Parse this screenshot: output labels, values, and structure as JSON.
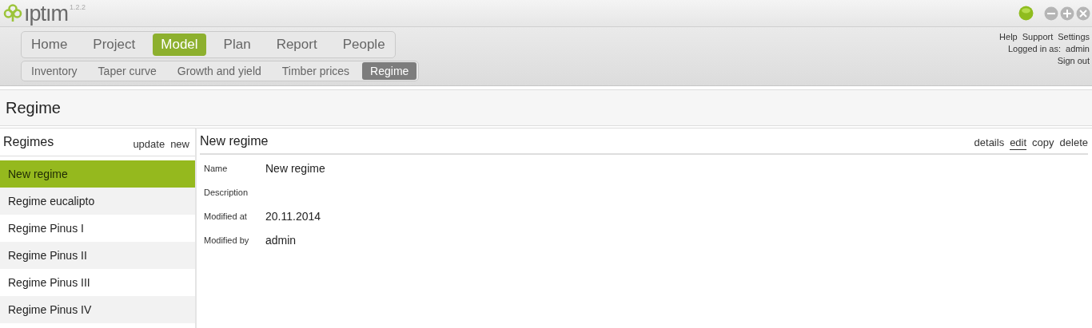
{
  "app": {
    "logo": "ıptım",
    "version": "1.2.2"
  },
  "main_nav": [
    {
      "label": "Home",
      "selected": false
    },
    {
      "label": "Project",
      "selected": false
    },
    {
      "label": "Model",
      "selected": true
    },
    {
      "label": "Plan",
      "selected": false
    },
    {
      "label": "Report",
      "selected": false
    },
    {
      "label": "People",
      "selected": false
    }
  ],
  "sub_nav": [
    {
      "label": "Inventory",
      "selected": false
    },
    {
      "label": "Taper curve",
      "selected": false
    },
    {
      "label": "Growth and yield",
      "selected": false
    },
    {
      "label": "Timber prices",
      "selected": false
    },
    {
      "label": "Regime",
      "selected": true
    }
  ],
  "user_menu": {
    "links": [
      "Help",
      "Support",
      "Settings"
    ],
    "logged_in_label": "Logged in as:",
    "user": "admin",
    "sign_out": "Sign out"
  },
  "page_title": "Regime",
  "list_panel": {
    "title": "Regimes",
    "actions": [
      "update",
      "new"
    ],
    "items": [
      {
        "label": "New regime",
        "selected": true
      },
      {
        "label": "Regime eucalipto",
        "selected": false
      },
      {
        "label": "Regime Pinus I",
        "selected": false
      },
      {
        "label": "Regime Pinus II",
        "selected": false
      },
      {
        "label": "Regime Pinus III",
        "selected": false
      },
      {
        "label": "Regime Pinus IV",
        "selected": false
      }
    ]
  },
  "detail_panel": {
    "title": "New regime",
    "tabs": [
      {
        "label": "details",
        "selected": false
      },
      {
        "label": "edit",
        "selected": true
      },
      {
        "label": "copy",
        "selected": false
      },
      {
        "label": "delete",
        "selected": false
      }
    ],
    "fields": [
      {
        "label": "Name",
        "value": "New regime"
      },
      {
        "label": "Description"
      },
      {
        "label": "Modified at",
        "value": "20.11.2014"
      },
      {
        "label": "Modified by",
        "value": "admin"
      }
    ]
  }
}
